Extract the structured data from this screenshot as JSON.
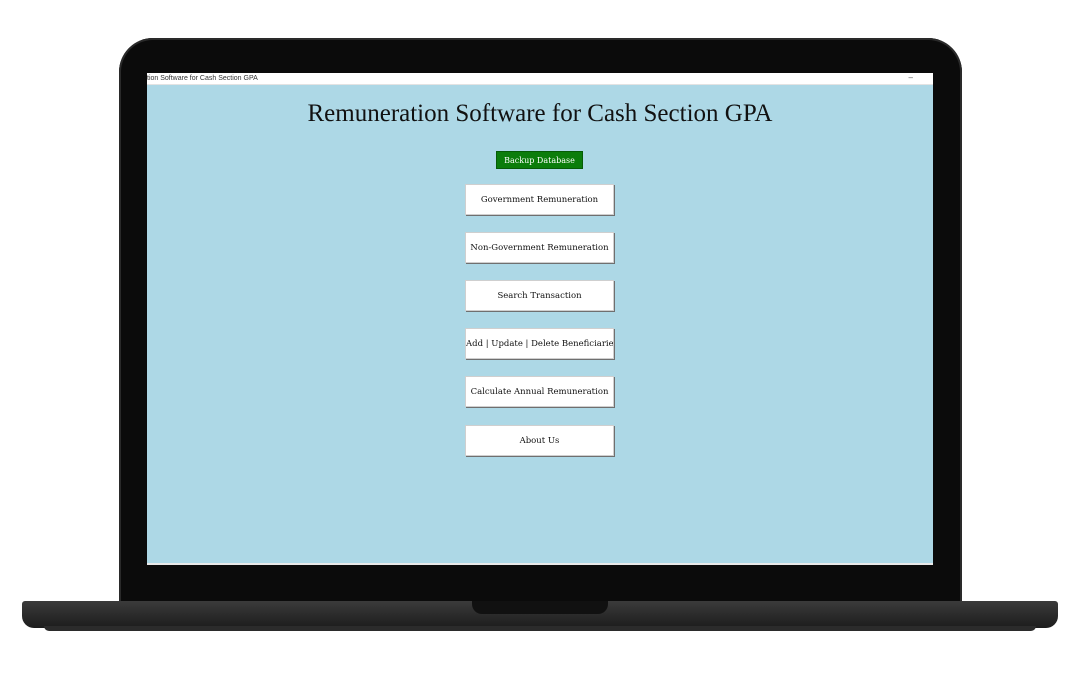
{
  "window": {
    "title": "tion Software for Cash Section GPA",
    "minimize_glyph": "–"
  },
  "app": {
    "title": "Remuneration Software for Cash Section GPA",
    "backup_label": "Backup Database",
    "menu": [
      "Government Remuneration",
      "Non-Government Remuneration",
      "Search Transaction",
      "Add | Update | Delete Beneficiaries",
      "Calculate Annual Remuneration",
      "About Us"
    ]
  },
  "colors": {
    "background": "#add8e6",
    "backup_button": "#0b7d0b",
    "menu_button": "#ffffff"
  }
}
